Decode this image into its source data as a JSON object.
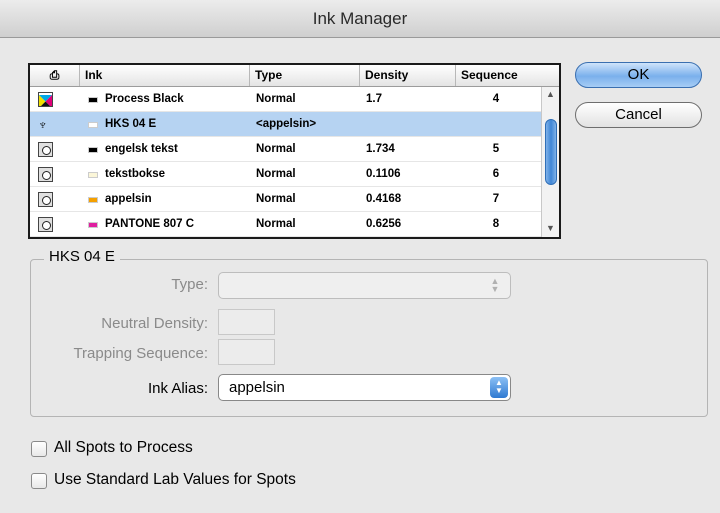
{
  "window": {
    "title": "Ink Manager"
  },
  "table": {
    "headers": {
      "icon": "",
      "ink": "Ink",
      "type": "Type",
      "density": "Density",
      "sequence": "Sequence"
    },
    "rows": [
      {
        "icon": "process-icon",
        "swatch": "#000000",
        "ink": "Process Black",
        "type": "Normal",
        "density": "1.7",
        "sequence": "4",
        "selected": false
      },
      {
        "icon": "alias-icon",
        "swatch": "#ffffff",
        "ink": "HKS 04 E",
        "type": "<appelsin>",
        "density": "",
        "sequence": "",
        "selected": true
      },
      {
        "icon": "spot-icon",
        "swatch": "#000000",
        "ink": "engelsk tekst",
        "type": "Normal",
        "density": "1.734",
        "sequence": "5",
        "selected": false
      },
      {
        "icon": "spot-icon",
        "swatch": "#fbf6d8",
        "ink": "tekstbokse",
        "type": "Normal",
        "density": "0.1106",
        "sequence": "6",
        "selected": false
      },
      {
        "icon": "spot-icon",
        "swatch": "#f5a000",
        "ink": "appelsin",
        "type": "Normal",
        "density": "0.4168",
        "sequence": "7",
        "selected": false
      },
      {
        "icon": "spot-icon",
        "swatch": "#e01fa0",
        "ink": "PANTONE 807 C",
        "type": "Normal",
        "density": "0.6256",
        "sequence": "8",
        "selected": false
      }
    ]
  },
  "buttons": {
    "ok": "OK",
    "cancel": "Cancel"
  },
  "details": {
    "group_title": "HKS 04 E",
    "type_label": "Type:",
    "type_value": "",
    "neutral_density_label": "Neutral Density:",
    "neutral_density_value": "",
    "trapping_sequence_label": "Trapping Sequence:",
    "trapping_sequence_value": "",
    "ink_alias_label": "Ink Alias:",
    "ink_alias_value": "appelsin"
  },
  "options": {
    "all_spots_to_process": {
      "label": "All Spots to Process",
      "checked": false
    },
    "use_standard_lab": {
      "label": "Use Standard Lab Values for Spots",
      "checked": false
    }
  }
}
